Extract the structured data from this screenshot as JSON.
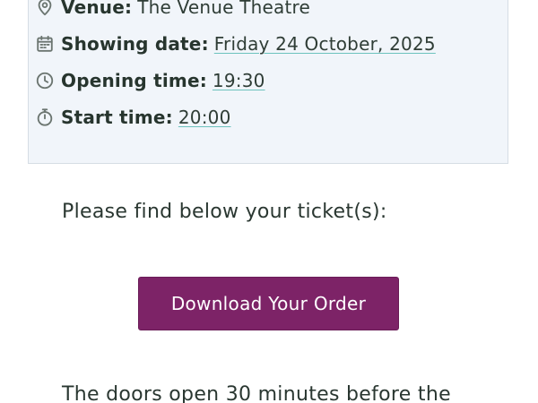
{
  "event_info": {
    "venue": {
      "label": "Venue:",
      "value": "The Venue Theatre",
      "icon": "location-pin-icon"
    },
    "showing_date": {
      "label": "Showing date:",
      "value": "Friday 24 October, 2025",
      "icon": "calendar-icon"
    },
    "opening_time": {
      "label": "Opening time:",
      "value": "19:30",
      "icon": "clock-icon"
    },
    "start_time": {
      "label": "Start time:",
      "value": "20:00",
      "icon": "stopwatch-icon"
    }
  },
  "tickets_intro": "Please find below your ticket(s):",
  "download_button_label": "Download Your Order",
  "doors_note": "The doors open 30 minutes before the",
  "colors": {
    "button_background": "#7d2367",
    "link_underline": "#6cc2bd",
    "info_box_background": "#f1f5fa",
    "text": "#2b3a33"
  }
}
